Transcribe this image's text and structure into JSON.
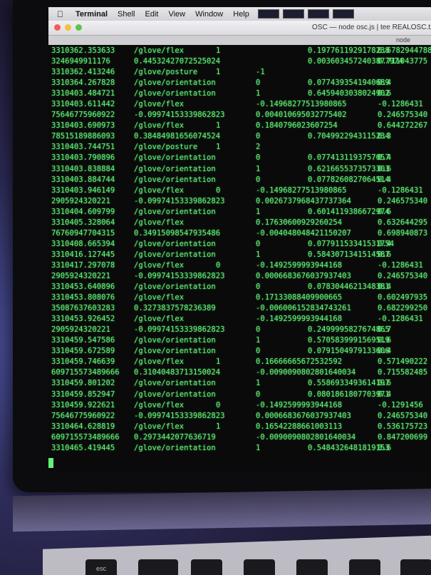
{
  "menubar": {
    "apple": "",
    "items": [
      "Terminal",
      "Shell",
      "Edit",
      "View",
      "Window",
      "Help"
    ]
  },
  "window": {
    "title": "OSC — node osc.js | tee REALOSC.txt",
    "tab": "node"
  },
  "terminal_rows": [
    [
      "3310362.353633",
      "/glove/flex",
      "1",
      "",
      "0.1977611929178238",
      "0.6782944788"
    ],
    [
      "3246949911176",
      "0.44532427072525024",
      "",
      "",
      "0.0036034572403877974",
      "0.711043775"
    ],
    [
      "3310362.413246",
      "/glove/posture",
      "1",
      "-1",
      "",
      ""
    ],
    [
      "3310364.267828",
      "/glove/orientation",
      "",
      "0",
      "0.0774393541940689",
      "0.4"
    ],
    [
      "3310403.484721",
      "/glove/orientation",
      "",
      "1",
      "0.6459403038024902",
      "0.6"
    ],
    [
      "3310403.611442",
      "/glove/flex",
      "",
      "-0.14968277513980865",
      "",
      "-0.1286431"
    ],
    [
      "75646775960922",
      "-0.09974153339862823",
      "",
      "0.004010695032775402",
      "",
      "0.246575340"
    ],
    [
      "3310403.690973",
      "/glove/flex",
      "1",
      "0.1840796023607254",
      "",
      "0.644272267"
    ],
    [
      "78515189886093",
      "0.38484981656074524",
      "",
      "0",
      "0.7049922943115234",
      "0.3"
    ],
    [
      "3310403.744751",
      "/glove/posture",
      "1",
      "2",
      "",
      ""
    ],
    [
      "3310403.790896",
      "/glove/orientation",
      "",
      "0",
      "0.0774131193757057",
      "0.4"
    ],
    [
      "3310403.838884",
      "/glove/orientation",
      "",
      "1",
      "0.6216655373573303",
      "0.6"
    ],
    [
      "3310403.884744",
      "/glove/orientation",
      "",
      "0",
      "0.0778260827064514",
      "0.4"
    ],
    [
      "3310403.946149",
      "/glove/flex",
      "0",
      "-0.14968277513980865",
      "",
      "-0.1286431"
    ],
    [
      "2905924320221",
      "-0.09974153339862823",
      "",
      "0.0026737968437737364",
      "",
      "0.246575340"
    ],
    [
      "3310404.609799",
      "/glove/orientation",
      "",
      "1",
      "0.6014119386672974",
      "0.6"
    ],
    [
      "3310405.328064",
      "/glove/flex",
      "",
      "0.17630600929260254",
      "",
      "0.632644295"
    ],
    [
      "76760947704315",
      "0.34915098547935486",
      "",
      "-0.004048048421150207",
      "",
      "0.698940873"
    ],
    [
      "3310408.665394",
      "/glove/orientation",
      "",
      "0",
      "0.07791153341531754",
      "0.4"
    ],
    [
      "3310416.127445",
      "/glove/orientation",
      "",
      "1",
      "0.5843071341514587",
      "0.6"
    ],
    [
      "3310417.297078",
      "/glove/flex",
      "0",
      "-0.1492599993944168",
      "",
      "-0.1286431"
    ],
    [
      "2905924320221",
      "-0.09974153339862823",
      "",
      "0.0006683676037937403",
      "",
      "0.246575340"
    ],
    [
      "3310453.640896",
      "/glove/orientation",
      "",
      "0",
      "0.0783044621348381",
      "0.4"
    ],
    [
      "3310453.808076",
      "/glove/flex",
      "",
      "0.17133088409900665",
      "",
      "0.602497935"
    ],
    [
      "35087637603283",
      "0.3273837578236389",
      "",
      "-0.006006152834743261",
      "",
      "0.682299250"
    ],
    [
      "3310453.926452",
      "/glove/flex",
      "",
      "-0.1492599993944168",
      "",
      "-0.1286431"
    ],
    [
      "2905924320221",
      "-0.09974153339862823",
      "",
      "0",
      "0.2499995827674865",
      "0.7"
    ],
    [
      "3310459.547586",
      "/glove/orientation",
      "",
      "1",
      "0.5705839991569519",
      "0.6"
    ],
    [
      "3310459.672589",
      "/glove/orientation",
      "",
      "0",
      "0.0791504979133606",
      "0.4"
    ],
    [
      "3310459.746639",
      "/glove/flex",
      "1",
      "0.16666665672532592",
      "",
      "0.571490222"
    ],
    [
      "609715573489666",
      "0.31040483713150024",
      "",
      "-0.0090090802801640034",
      "",
      "0.715582485"
    ],
    [
      "3310459.801202",
      "/glove/orientation",
      "",
      "1",
      "0.5586933493614197",
      "0.6"
    ],
    [
      "3310459.852947",
      "/glove/orientation",
      "",
      "0",
      "0.0801861807703971",
      "0.4"
    ],
    [
      "3310459.922621",
      "/glove/flex",
      "0",
      "-0.1492599993944168",
      "",
      "-0.1291456"
    ],
    [
      "75646775960922",
      "-0.09974153339862823",
      "",
      "0.0006683676037937403",
      "",
      "0.246575340"
    ],
    [
      "3310464.628819",
      "/glove/flex",
      "1",
      "0.16542288661003113",
      "",
      "0.536175723"
    ],
    [
      "609715573489666",
      "0.2973442077636719",
      "",
      "-0.0090090802801640034",
      "",
      "0.847200699"
    ],
    [
      "3310465.419445",
      "/glove/orientation",
      "",
      "1",
      "0.5484326481819153",
      "0.6"
    ]
  ],
  "keyboard": {
    "keys": [
      "esc",
      "",
      "",
      "",
      "",
      "",
      ""
    ]
  }
}
